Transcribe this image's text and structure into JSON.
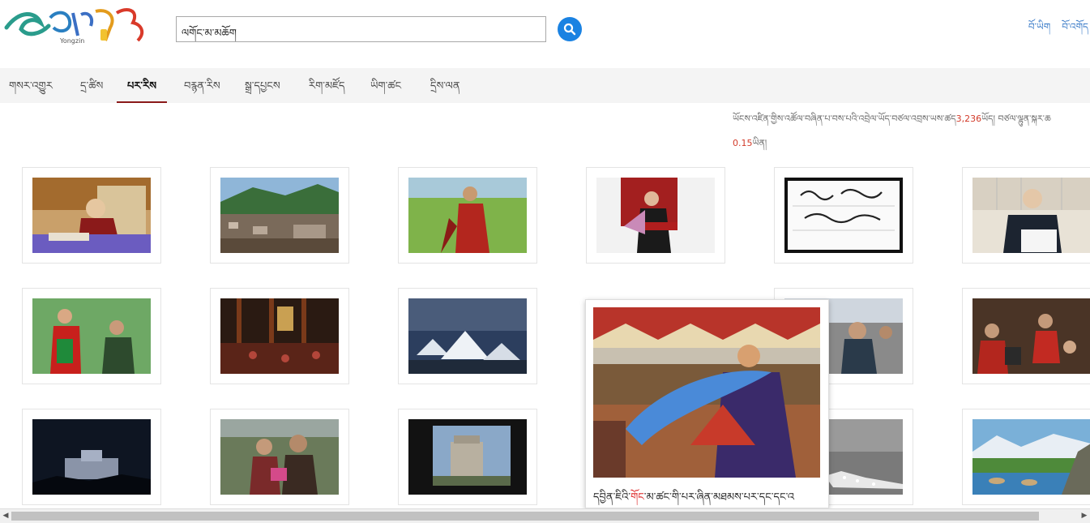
{
  "header": {
    "search_value": "ལགོང་མ་མཆོག",
    "links": [
      "བོ་ཡིག",
      "བོ་འགོད"
    ]
  },
  "nav": {
    "items": [
      "གསར་འགྱུར",
      "དྲ་ཚིས",
      "པར་རིས",
      "བརྙན་རིས",
      "སྒྲ་དཔྱངས",
      "རིག་མཛོད",
      "ཡིག་ཚང",
      "དྲིས་ལན"
    ],
    "active_index": 2
  },
  "stats": {
    "text_before": "ཡོངས་འཛིན་གྱིས་འཚོལ་བཞིན་པ་བས་པའི་འབྲེལ་ཡོད་བཙལ་འབྲས་ཡས་ཚད",
    "count": "3,236",
    "text_middle": "ཡོད། བཙལ་ལྷུན་སྐར་ཆ",
    "time": "0.15",
    "text_after": "ཡིན།"
  },
  "popup": {
    "caption_before": "དབྱིན་ཇིའི་",
    "caption_red": "གོང",
    "caption_after": "་མ་ཚང་གི་པར་ཞིན་མཐམས་པར་དང་དང་འ"
  },
  "colors": {
    "accent_blue": "#1a82e2",
    "nav_active_underline": "#8b1a1a",
    "highlight_red": "#d23b2a",
    "link_blue": "#3a7bc8"
  }
}
